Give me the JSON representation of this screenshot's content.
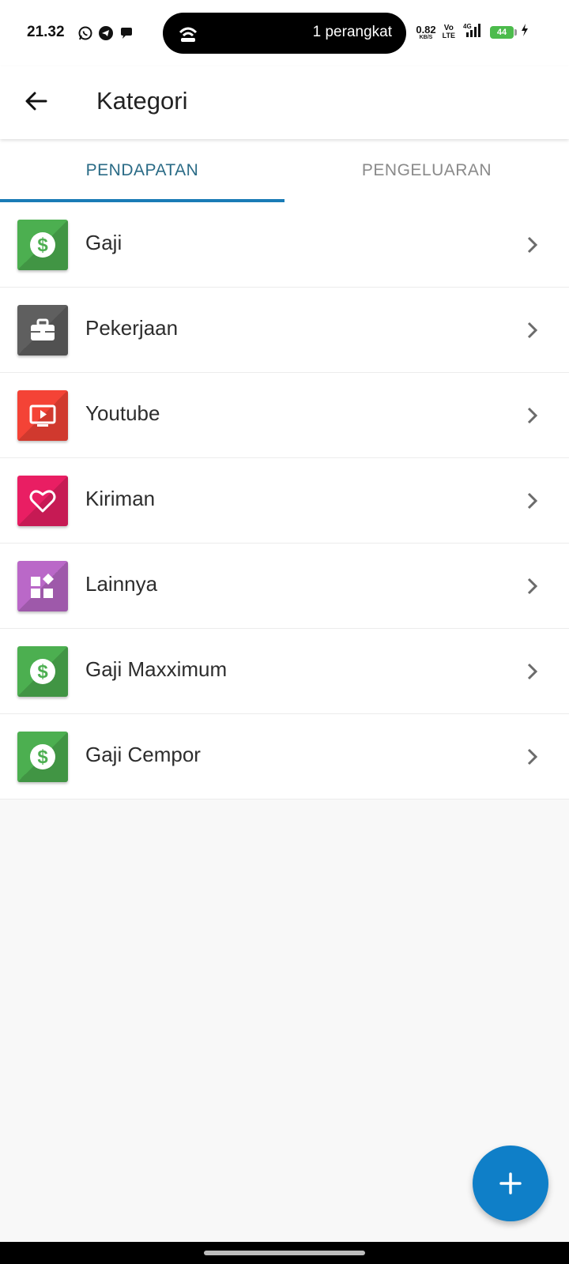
{
  "status_bar": {
    "time": "21.32",
    "notifications": [
      "whatsapp-icon",
      "telegram-icon",
      "chat-bubble-icon"
    ],
    "hotspot_text": "1 perangkat",
    "net_speed_value": "0.82",
    "net_speed_unit": "KB/S",
    "volte_top": "Vo",
    "volte_bottom": "LTE",
    "network": "4G",
    "battery": "44"
  },
  "app_bar": {
    "title": "Kategori",
    "back_icon": "arrow-left-icon"
  },
  "tabs": [
    {
      "label": "PENDAPATAN",
      "active": true
    },
    {
      "label": "PENGELUARAN",
      "active": false
    }
  ],
  "categories": [
    {
      "label": "Gaji",
      "icon": "dollar-icon",
      "color": "#4caf50"
    },
    {
      "label": "Pekerjaan",
      "icon": "briefcase-icon",
      "color": "#5f5f5f"
    },
    {
      "label": "Youtube",
      "icon": "play-screen-icon",
      "color": "#f44336"
    },
    {
      "label": "Kiriman",
      "icon": "heart-icon",
      "color": "#e91e63"
    },
    {
      "label": "Lainnya",
      "icon": "widgets-icon",
      "color": "#ba68c8"
    },
    {
      "label": "Gaji Maxximum",
      "icon": "dollar-icon",
      "color": "#4caf50"
    },
    {
      "label": "Gaji Cempor",
      "icon": "dollar-icon",
      "color": "#4caf50"
    }
  ],
  "fab": {
    "icon": "plus-icon",
    "color": "#0f7fc8"
  },
  "colors": {
    "tab_active_text": "#2a6b86",
    "tab_indicator": "#1a7bb6",
    "tab_inactive_text": "#8a8a8a",
    "background": "#f8f8f8"
  }
}
